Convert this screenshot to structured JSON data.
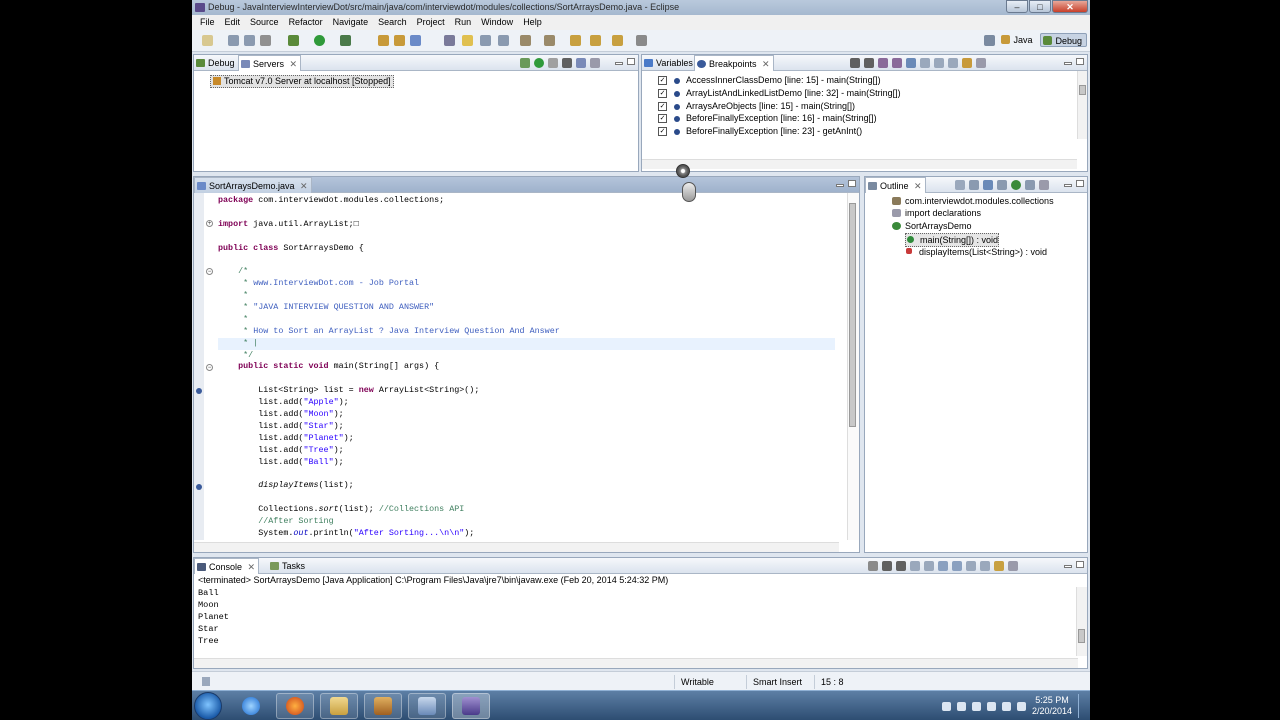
{
  "window": {
    "title": "Debug - JavaInterviewInterviewDot/src/main/java/com/interviewdot/modules/collections/SortArraysDemo.java - Eclipse",
    "minimize_label": "–",
    "maximize_label": "□",
    "close_label": "✕"
  },
  "menu": [
    "File",
    "Edit",
    "Source",
    "Refactor",
    "Navigate",
    "Search",
    "Project",
    "Run",
    "Window",
    "Help"
  ],
  "perspectives": {
    "java": "Java",
    "debug": "Debug"
  },
  "debug_view": {
    "tabs": [
      "Debug",
      "Servers"
    ],
    "server_row": "Tomcat v7.0 Server at localhost  [Stopped]"
  },
  "breakpoints_view": {
    "tabs": [
      "Variables",
      "Breakpoints"
    ],
    "check_mark": "✓",
    "items": [
      "AccessInnerClassDemo [line: 15] - main(String[])",
      "ArrayListAndLinkedListDemo [line: 32] - main(String[])",
      "ArraysAreObjects [line: 15] - main(String[])",
      "BeforeFinallyException [line: 16] - main(String[])",
      "BeforeFinallyException [line: 23] - getAnInt()"
    ]
  },
  "editor": {
    "tab": "SortArraysDemo.java",
    "lines": [
      "package com.interviewdot.modules.collections;",
      "",
      "import java.util.ArrayList;□",
      "",
      "public class SortArraysDemo {",
      "",
      "    /*",
      "     * www.InterviewDot.com - Job Portal",
      "     *",
      "     * \"JAVA INTERVIEW QUESTION AND ANSWER\"",
      "     *",
      "     * How to Sort an ArrayList ? Java Interview Question And Answer",
      "     * |",
      "     */",
      "    public static void main(String[] args) {",
      "",
      "        List<String> list = new ArrayList<String>();",
      "        list.add(\"Apple\");",
      "        list.add(\"Moon\");",
      "        list.add(\"Star\");",
      "        list.add(\"Planet\");",
      "        list.add(\"Tree\");",
      "        list.add(\"Ball\");",
      "",
      "        displayItems(list);",
      "",
      "        Collections.sort(list); //Collections API",
      "        //After Sorting",
      "        System.out.println(\"After Sorting...\\n\\n\");"
    ]
  },
  "outline": {
    "tab": "Outline",
    "items": [
      "com.interviewdot.modules.collections",
      "import declarations",
      "SortArraysDemo",
      "main(String[]) : void",
      "displayItems(List<String>) : void"
    ]
  },
  "console": {
    "tabs": [
      "Console",
      "Tasks"
    ],
    "header": "<terminated> SortArraysDemo [Java Application] C:\\Program Files\\Java\\jre7\\bin\\javaw.exe (Feb 20, 2014 5:24:32 PM)",
    "lines": [
      "Ball",
      "Moon",
      "Planet",
      "Star",
      "Tree"
    ]
  },
  "status": {
    "writable": "Writable",
    "insert_mode": "Smart Insert",
    "position": "15 : 8"
  },
  "clock": {
    "time": "5:25 PM",
    "date": "2/20/2014"
  }
}
